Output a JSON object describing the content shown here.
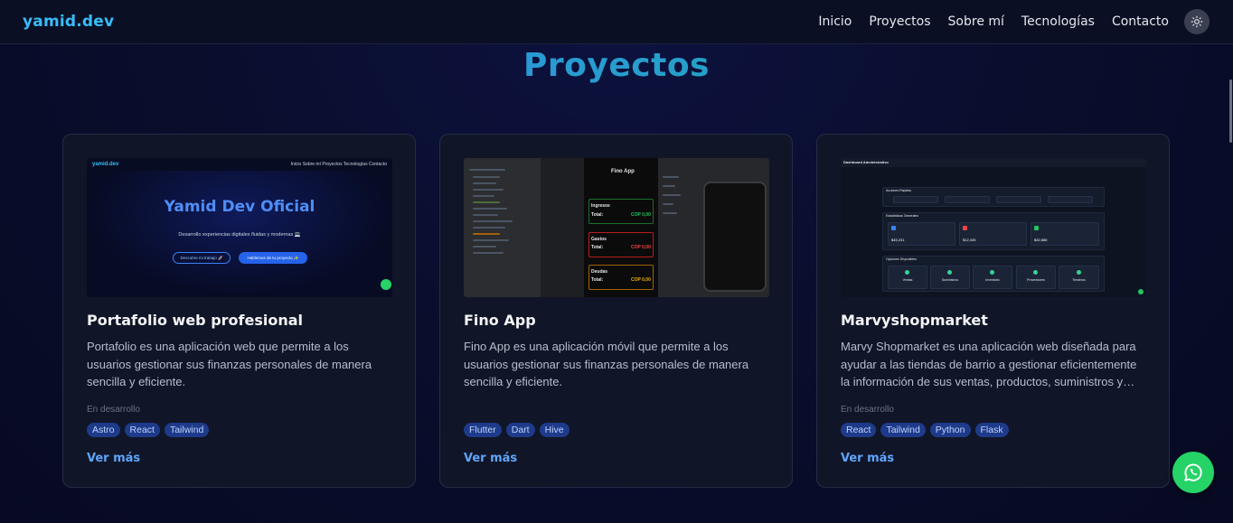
{
  "nav": {
    "brand": "yamid.dev",
    "links": [
      "Inicio",
      "Proyectos",
      "Sobre mí",
      "Tecnologías",
      "Contacto"
    ],
    "theme_icon": "sun-icon"
  },
  "section": {
    "title": "Proyectos"
  },
  "projects": [
    {
      "title": "Portafolio web profesional",
      "description": "Portafolio es una aplicación web que permite a los usuarios gestionar sus finanzas personales de manera sencilla y eficiente.",
      "status": "En desarrollo",
      "tags": [
        "Astro",
        "React",
        "Tailwind"
      ],
      "link": "Ver más",
      "thumb": {
        "brand": "yamid.dev",
        "links": "Inicio   Sobre mí   Proyectos   Tecnologías   Contacto",
        "hero": "Yamid Dev Oficial",
        "subtitle": "Desarrollo experiencias digitales fluidas y modernas 💻",
        "button_secondary": "Descubre mi trabajo 🚀",
        "button_primary": "Hablemos de tu proyecto ✨"
      }
    },
    {
      "title": "Fino App",
      "description": "Fino App es una aplicación móvil que permite a los usuarios gestionar sus finanzas personales de manera sencilla y eficiente.",
      "status": "",
      "tags": [
        "Flutter",
        "Dart",
        "Hive"
      ],
      "link": "Ver más",
      "thumb": {
        "app_title": "Fino App",
        "income": "Ingresos",
        "expenses": "Gastos",
        "debts": "Deudas",
        "total": "Total:",
        "amount": "COP 0,00"
      }
    },
    {
      "title": "Marvyshopmarket",
      "description": "Marvy Shopmarket es una aplicación web diseñada para ayudar a las tiendas de barrio a gestionar eficientemente la información de sus ventas, productos, suministros y…",
      "status": "En desarrollo",
      "tags": [
        "React",
        "Tailwind",
        "Python",
        "Flask"
      ],
      "link": "Ver más",
      "thumb": {
        "header": "Dashboard Administrativo",
        "quick": "Acciones Rápidas",
        "stats": "Estadísticas Generales",
        "options": "Opciones Disponibles",
        "stat_values": [
          "$45,231",
          "$12,345",
          "$32,886"
        ],
        "option_labels": [
          "Ventas",
          "Suministros",
          "Inventario",
          "Proveedores",
          "Tenderos"
        ]
      }
    }
  ],
  "whatsapp": {
    "icon": "whatsapp-icon"
  },
  "colors": {
    "accent": "#38bdf8",
    "link": "#60a5fa",
    "tag_bg": "#1e3a8a",
    "whatsapp": "#25d366"
  }
}
